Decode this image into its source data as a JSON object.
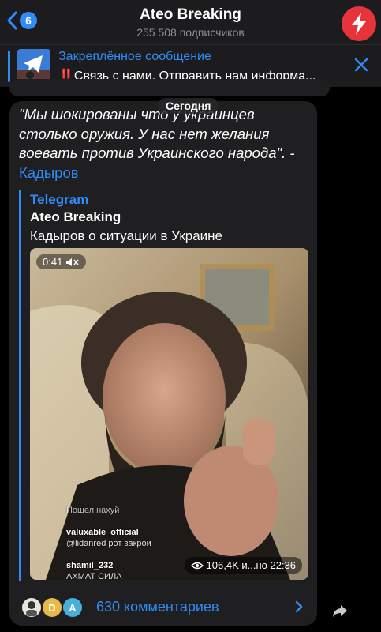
{
  "header": {
    "back_count": "6",
    "title": "Ateo Breaking",
    "subtitle": "255 508 подписчиков"
  },
  "pinned": {
    "title": "Закреплённое сообщение",
    "text": "‼️Связь с нами. Отправить нам информа..."
  },
  "date_label": "Сегодня",
  "message": {
    "quote": "\"Мы шокированы  что у украинцев столько оружия. У нас нет желания воевать против Украинского народа\". - ",
    "author_link": "Кадыров",
    "source_label": "Telegram",
    "source_name": "Ateo Breaking",
    "source_desc": "Кадыров о ситуации в Украине",
    "video": {
      "duration": "0:41",
      "stats": "106,4K и...но 22:36",
      "overlay_comments": [
        "Пошел нахуй",
        "valuxable_official",
        "@lidanred рот закрои",
        "shamil_232",
        "АХМАТ СИЛА"
      ]
    }
  },
  "comments": {
    "label": "630 комментариев",
    "avatars": [
      "",
      "D",
      "A"
    ]
  },
  "colors": {
    "accent": "#2f8cf5",
    "bubble": "#1f1f21",
    "header_bg": "#1c1c1e",
    "avatar_red": "#e5343c"
  }
}
